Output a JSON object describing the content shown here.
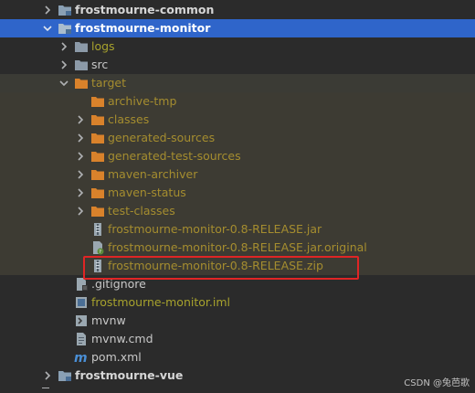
{
  "tree": {
    "items": [
      {
        "label": "frostmourne-common",
        "kind": "module"
      },
      {
        "label": "frostmourne-monitor",
        "kind": "module"
      },
      {
        "label": "logs",
        "kind": "folder"
      },
      {
        "label": "src",
        "kind": "folder"
      },
      {
        "label": "target",
        "kind": "folder-excluded"
      },
      {
        "label": "archive-tmp",
        "kind": "folder-excluded"
      },
      {
        "label": "classes",
        "kind": "folder-excluded"
      },
      {
        "label": "generated-sources",
        "kind": "folder-excluded"
      },
      {
        "label": "generated-test-sources",
        "kind": "folder-excluded"
      },
      {
        "label": "maven-archiver",
        "kind": "folder-excluded"
      },
      {
        "label": "maven-status",
        "kind": "folder-excluded"
      },
      {
        "label": "test-classes",
        "kind": "folder-excluded"
      },
      {
        "label": "frostmourne-monitor-0.8-RELEASE.jar",
        "kind": "archive"
      },
      {
        "label": "frostmourne-monitor-0.8-RELEASE.jar.original",
        "kind": "file-original"
      },
      {
        "label": "frostmourne-monitor-0.8-RELEASE.zip",
        "kind": "archive"
      },
      {
        "label": ".gitignore",
        "kind": "gitignore"
      },
      {
        "label": "frostmourne-monitor.iml",
        "kind": "iml"
      },
      {
        "label": "mvnw",
        "kind": "script"
      },
      {
        "label": "mvnw.cmd",
        "kind": "text"
      },
      {
        "label": "pom.xml",
        "kind": "maven"
      },
      {
        "label": "frostmourne-vue",
        "kind": "module"
      }
    ]
  },
  "watermark": "CSDN @兔芭歌",
  "colors": {
    "background": "#2b2b2b",
    "selection": "#2f65ca",
    "excluded_bg": "#3d3b33",
    "olive_text": "#a7a22d",
    "folder_orange": "#d9822b",
    "highlight_border": "#e02525"
  }
}
